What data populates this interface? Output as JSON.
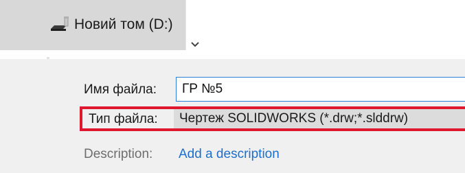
{
  "navigation": {
    "drive_label": "Новий том (D:)",
    "drive_icon": "drive-icon",
    "expand_icon": "chevron-down-icon"
  },
  "save_form": {
    "filename_label": "Имя файла:",
    "filename_value": "ГР №5",
    "filetype_label": "Тип файла:",
    "filetype_value": "Чертеж SOLIDWORKS (*.drw;*.slddrw)",
    "description_label": "Description:",
    "description_link": "Add a description"
  },
  "colors": {
    "highlight_border": "#e0182f",
    "input_border": "#2b7fd8",
    "link": "#1a6fcf",
    "selected_nav_bg": "#d8d8d8",
    "panel_bg": "#f0f0f0"
  }
}
